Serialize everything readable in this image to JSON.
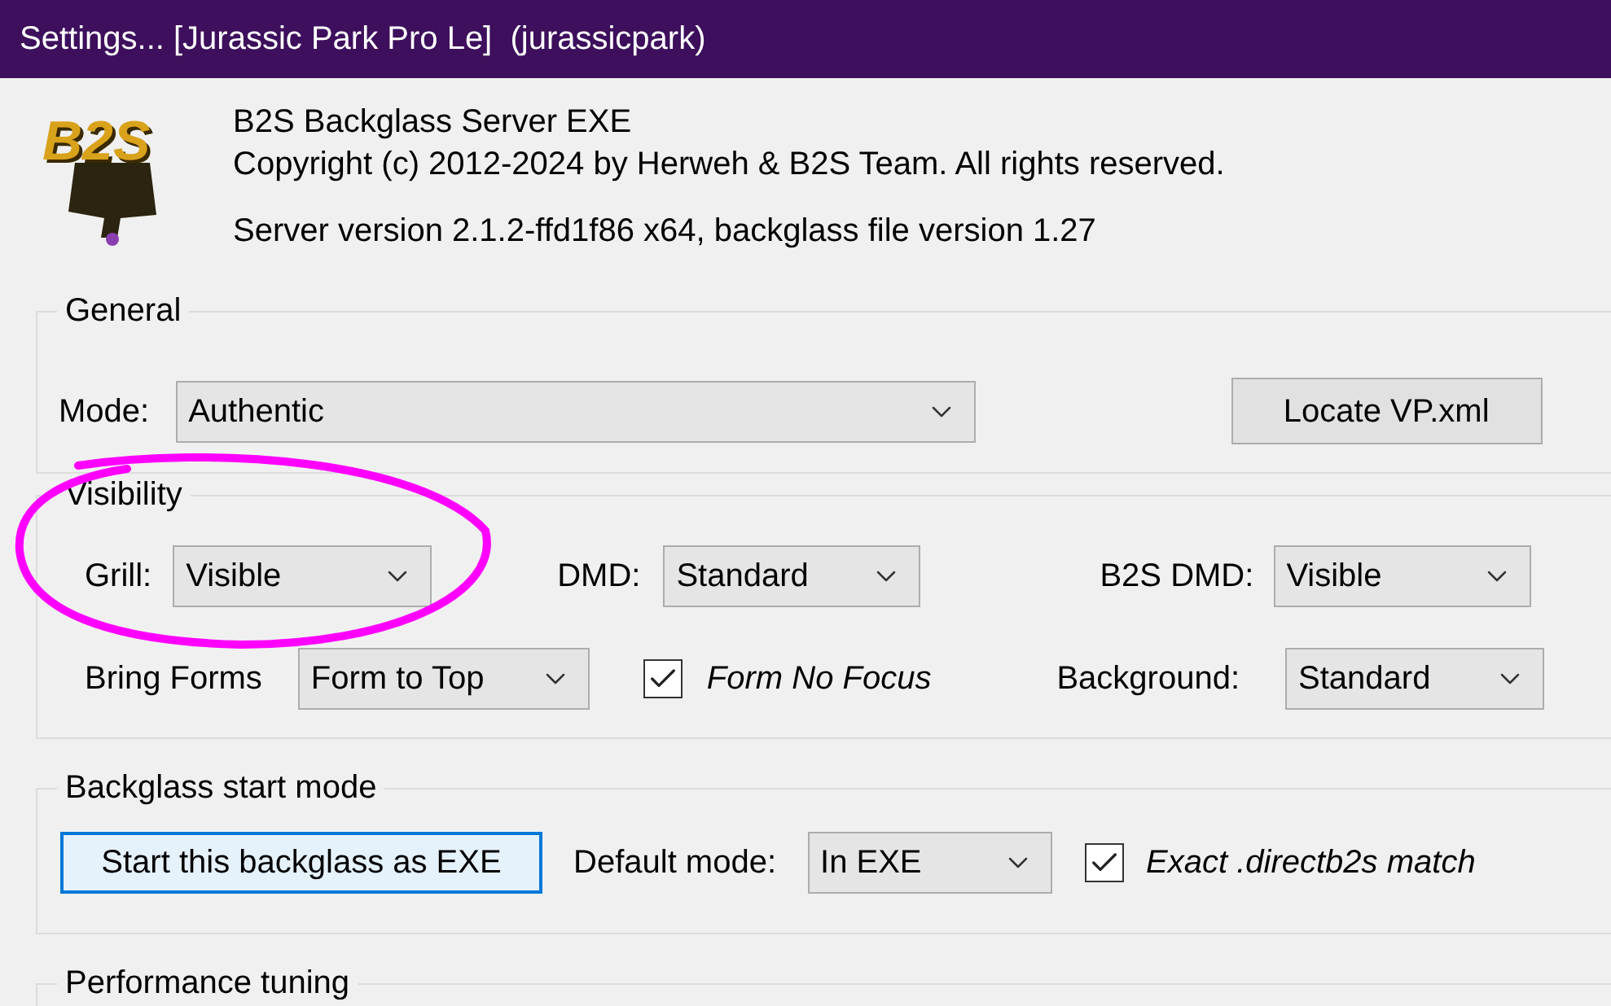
{
  "window": {
    "title": "Settings... [Jurassic Park Pro Le]  (jurassicpark)"
  },
  "header": {
    "logo_text": "B2S",
    "product": "B2S Backglass Server EXE",
    "copyright": "Copyright (c) 2012-2024 by Herweh & B2S Team. All rights reserved.",
    "version": "Server version 2.1.2-ffd1f86 x64, backglass file version 1.27"
  },
  "general": {
    "title": "General",
    "mode_label": "Mode:",
    "mode_value": "Authentic",
    "locate_button": "Locate VP.xml"
  },
  "visibility": {
    "title": "Visibility",
    "grill_label": "Grill:",
    "grill_value": "Visible",
    "dmd_label": "DMD:",
    "dmd_value": "Standard",
    "b2s_dmd_label": "B2S DMD:",
    "b2s_dmd_value": "Visible",
    "bring_forms_label": "Bring Forms",
    "bring_forms_value": "Form to Top",
    "form_no_focus": {
      "label": "Form No Focus",
      "checked": true
    },
    "background_label": "Background:",
    "background_value": "Standard"
  },
  "start_mode": {
    "title": "Backglass start mode",
    "button": "Start this backglass as EXE",
    "default_label": "Default mode:",
    "default_value": "In EXE",
    "exact_match": {
      "label": "Exact .directb2s match",
      "checked": true
    }
  },
  "performance": {
    "title": "Performance tuning"
  }
}
